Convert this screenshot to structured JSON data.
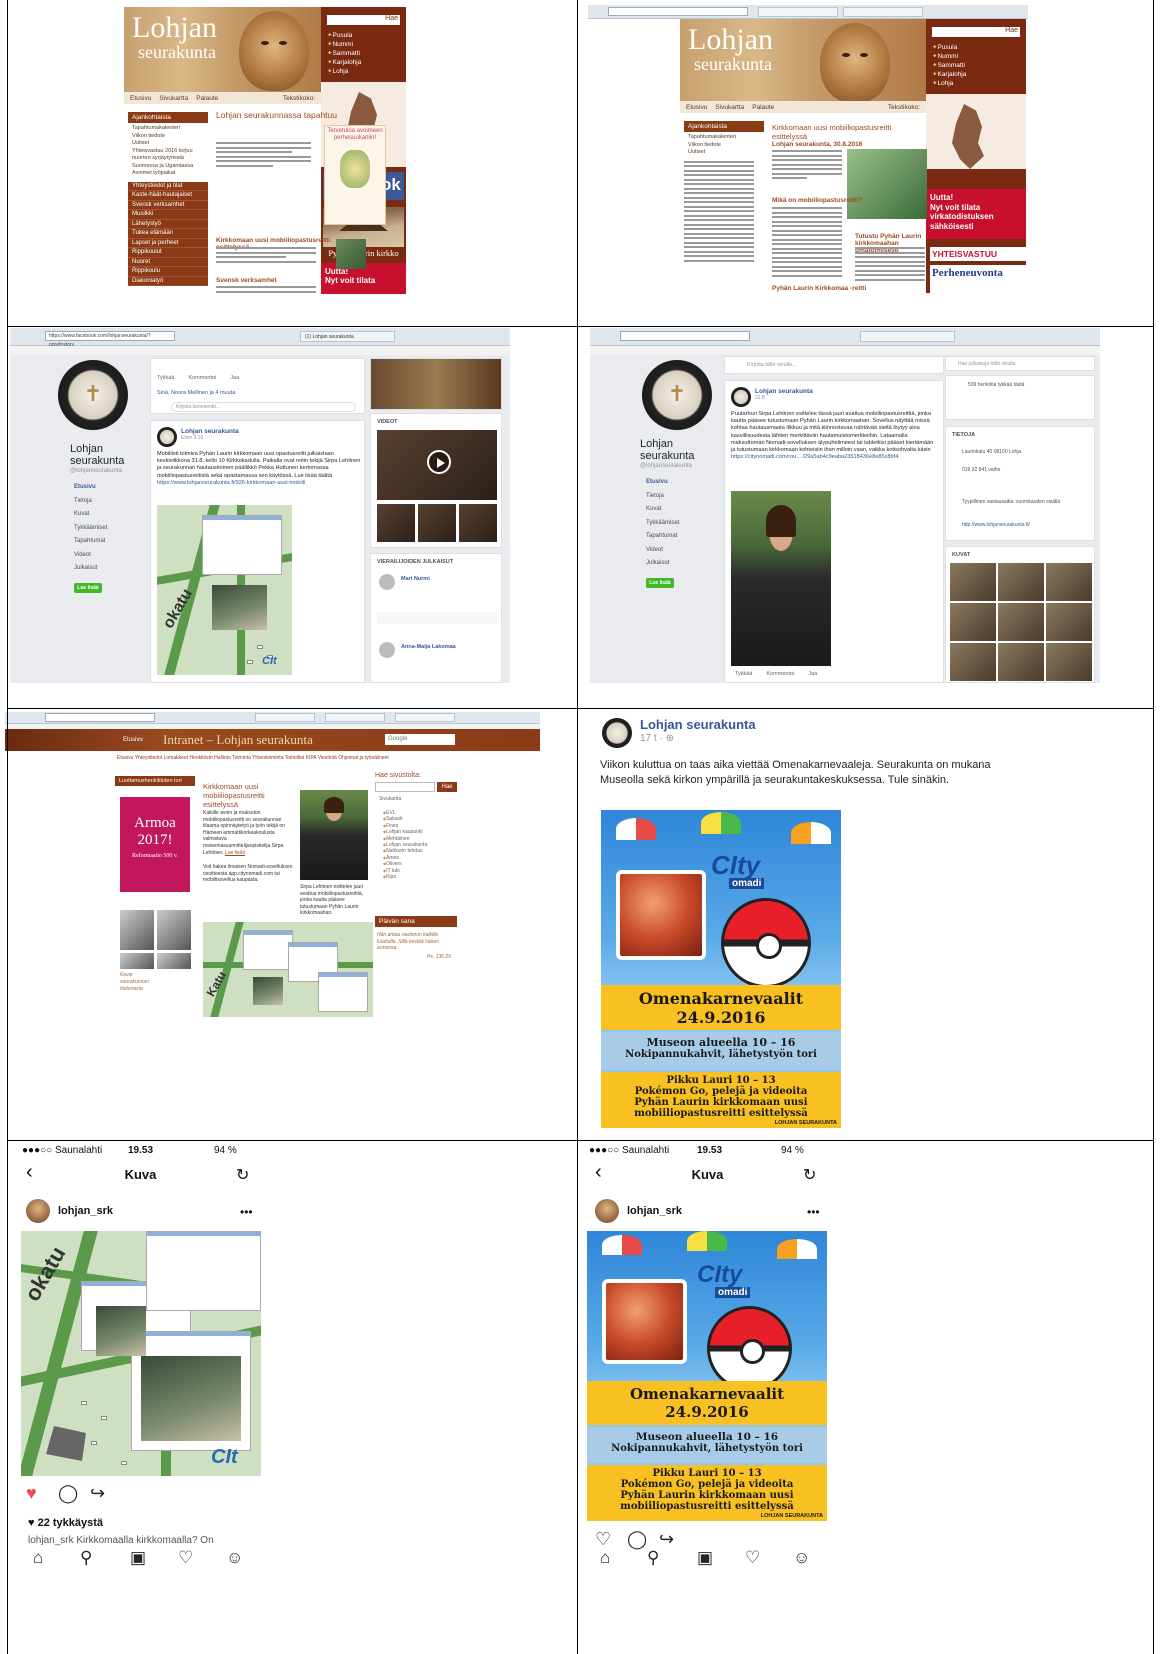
{
  "website": {
    "logo_line1": "Lohjan",
    "logo_line2": "seurakunta",
    "search_button": "Hae",
    "parishes": [
      "Pusula",
      "Nummi",
      "Sammatti",
      "Karjalohja",
      "Lohja"
    ],
    "nav": [
      "Etusivu",
      "Sivukartta",
      "Palaute"
    ],
    "text_size": "Tekstikoko:",
    "menu_head": "Ajankohtaista",
    "menu_items": [
      "Tapahtumakalenteri",
      "Viikon tiedote",
      "Uutiset",
      "Yhteisvastuu 2016 torjuu nuorten syrjäytymistä Suomessa ja Ugandassa",
      "Avoimet työpaikat"
    ],
    "brown_items": [
      "Yhteystiedot ja tilat",
      "Kaste-häät-hautajaiset",
      "Svensk verksamhet",
      "Musiikki",
      "Lähetystyö",
      "Tukea elämään",
      "Lapset ja perheet",
      "Rippikoulut",
      "Nuoret",
      "Rippikoulu",
      "Diakoniatyö"
    ],
    "content_title": "Lohjan seurakunnassa tapahtuu",
    "welcome_title": "Tervetuloa avoimeen perhesuukarliin!",
    "subhead1": "Kirkkomaan uusi mobiiliopastusreitti esittelyssä",
    "subhead2": "Svensk verksamhet",
    "facebook": "facebook",
    "church_caption": "Pyhän Laurin kirkko",
    "uutta": "Uutta!",
    "nyt_volt": "Nyt voit tilata",
    "right_title": "Kirkkomaan uusi mobiiliopastusreitti esittelyssä",
    "right_date": "Lohjan seurakunta, 30.8.2016",
    "right_q": "Mikä on mobiiliopastusreitti?",
    "right_tutustu": "Tutustu Pyhän Laurin kirkkomaahan omatoimisesti",
    "right_lauri": "Pyhän Laurin Kirkkomaa -reitti",
    "red_box_lines": [
      "Uutta!",
      "Nyt voit tilata",
      "virkatodistuksen",
      "sähköisesti"
    ],
    "yhteisvastuu": "YHTEISVASTUU",
    "perheneuvonta": "Perheneuvonta"
  },
  "facebook_page": {
    "name_line1": "Lohjan",
    "name_line2": "seurakunta",
    "handle": "@lohjanseurakunta",
    "nav": [
      "Etusivu",
      "Tietoja",
      "Kuvat",
      "Tykkäämiset",
      "Tapahtumat",
      "Videot",
      "Julkaisut"
    ],
    "like_button": "Lue lisää",
    "post_author": "Lohjan seurakunta",
    "post_meta": "Eilen 9.10",
    "post_text": "Mobiilisti toimiva Pyhän Laurin kirkkomaan uusi opastusreitti julkaistaan keskiviikkona 31.8. kello 10 Kirkkokadulla. Paikalla ovat reitin tekijä Sirpa Lehtinen ja seurakunnan hautaustoimen päällikkö Pekka Huttunen kertomassa mobiiliopastusreitistä sekä opastamassa sen käytössä. Lue lisää täältä",
    "post_link": "https://www.lohjanseurakunta.fi/926-kirkkomaan-uusi-mobiili",
    "url": "https://www.facebook.com/lohjanseurakunta/?pnref=story",
    "tab": "(1) Lohjan seurakunta",
    "videot": "VIDEOT",
    "visitors": "VIERAILIJOIDEN JULKAISUT",
    "visitor1": "Mari Nurmi",
    "visitor2": "Anna-Maija Lakomaa",
    "actions": [
      "Tykkää",
      "Kommentoi",
      "Jaa"
    ],
    "comment_placeholder": "Kirjoita kommentti...",
    "likers": "Sinä, Noora Mellinen ja 4 muuta",
    "post2_text": "Puutarhuri Sirpa Lehtinen esittelee tässä juuri avattua mobiiliopastusreittiä, jonka kautta pääsee tutustumaan Pyhän Laurin kirkkomaahan. Sovellus näyttää missä kohtaa hautausmaata liikkuu ja mitä kiinnostavaa nähtävää sieltä löytyy aina kasvillisuudesta lähtien merkittäviin hautamuistomerkkeihin. Lataamalla maksuttoman Nomadi-sovelluksen älypuhelimeesi tai tablettiisi pääset kiertämään ja tutustumaan kirkkomaan kohteisiin ihan milloin vaan, vaikka kotisohvalta käsin",
    "post2_link": "https://citynomadi.com/rou... /29a5ab4c9eaba23518436e8e85c8bf4",
    "post2_meta": "31.8",
    "write_placeholder": "Kirjoita tälle sivulle...",
    "tietoja": "TIETOJA",
    "kuvat": "KUVAT",
    "info": [
      "Laurinkatu 40 08100 Lohja",
      "019 32 841 vaihe",
      "Tyypillinen vastausaika: vuorokauden sisällä",
      "http://www.lohjanseurakunta.fi/"
    ],
    "likes_count": "539 henkilöä tykkää tästä",
    "search_placeholder": "Hae julkaisuja tältä sivulta"
  },
  "intranet": {
    "home": "Etusivu",
    "title": "Intranet – Lohjan seurakunta",
    "google": "Google",
    "menu": "Etusivu  Yhteystiedot  Lomakkeet  Henkilöstö  Hallinto  Toiminta  Yhteistoiminta  Toimitilat  KIPA  Viestintä  Ohjeimat ja työvälineet",
    "luottamus": "Luottamushenkilöiden tori",
    "armoa_line1": "Armoa",
    "armoa_line2": "2017!",
    "armoa_line3": "Reformaatio 500 v.",
    "head": "Kirkkomaan uusi mobiiliopastusreitti esittelyssä",
    "text": "Kaikille avoin ja maksuton mobiiliopastusreitti on seurakunnan tilaama opinnäytetyö ja työn tekijä on Hämeen ammattikorkeakoulusta valmistuva maisemasuunnittelijaopiskelija Sirpa Lehtinen.",
    "lue_lisaa": "Lue lisää",
    "text2": "Voit hakea ilmaisen Nomadi-sovelluksen osoitteesta app.citynomadi.com tai mobiilisoveIlus kaupasta.",
    "caption": "Sirpa Lehtinen esittelee juuri avattua mobiiliopastusreittiä, jonka kautta pääsee tutustumaan Pyhän Laurin kirkkomaahan.",
    "hae": "Hae sivustolta:",
    "hae_btn": "Hae",
    "sivukartta": "Sivukartta",
    "sidebar": [
      "EVL",
      "Sakasti",
      "Fines",
      "Lohjan kaupunki",
      "Mehtäinen",
      "Lohjan seurakunta",
      "Nahkurin tehdas",
      "Ames",
      "Olivers",
      "IT tuki",
      "Kipa"
    ],
    "paivan_sana": "Päivän sana",
    "paivan_text": "Hän antaa raviinnon kaikille luoduille. Sillä kestää hänen armonsa.",
    "psalm": "Ps. 136:25",
    "photo_caption": "Kuvia seurakunnan historiasta"
  },
  "fb_post": {
    "author": "Lohjan seurakunta",
    "meta": "17 t · ⊕",
    "text": "Viikon kuluttua on taas aika viettää Omenakarnevaaleja. Seurakunta on mukana Museolla sekä kirkon ympärillä ja seurakuntakeskuksessa. Tule sinäkin."
  },
  "poster": {
    "logo": "CIty",
    "logo2": "omadi",
    "title": "Omenakarnevaalit",
    "date": "24.9.2016",
    "museo1": "Museon alueella 10 – 16",
    "museo2": "Nokipannukahvit, lähetystyön tori",
    "pikku1": "Pikku Lauri 10 – 13",
    "pikku2": "Pokémon Go, pelejä ja videoita",
    "pikku3": "Pyhän Laurin kirkkomaan uusi",
    "pikku4": "mobiiliopastusreitti esittelyssä",
    "footer": "LOHJAN SEURAKUNTA"
  },
  "instagram": {
    "carrier": "●●●○○ Saunalahti",
    "time": "19.53",
    "battery_left": "94 %",
    "battery_right": "94 %",
    "title": "Kuva",
    "username": "lohjan_srk",
    "likes": "♥ 22 tykkäystä",
    "caption_cut": "lohjan_srk Kirkkomaalla kirkkomaalla? On",
    "more": "•••"
  },
  "icons": {
    "back": "chevron-left-icon",
    "reload": "reload-icon",
    "heart": "heart-icon",
    "comment": "comment-icon",
    "share": "share-icon",
    "home": "home-icon",
    "search": "search-icon",
    "camera": "camera-icon",
    "activity": "heart-outline-icon",
    "profile": "profile-icon"
  },
  "colors": {
    "lohja_brown": "#8a3a15",
    "facebook_blue": "#3b5998",
    "armoa_pink": "#c2185b",
    "poster_yellow": "#f8c020",
    "poster_blue": "#a8cce8",
    "ig_heart": "#ed4956"
  }
}
